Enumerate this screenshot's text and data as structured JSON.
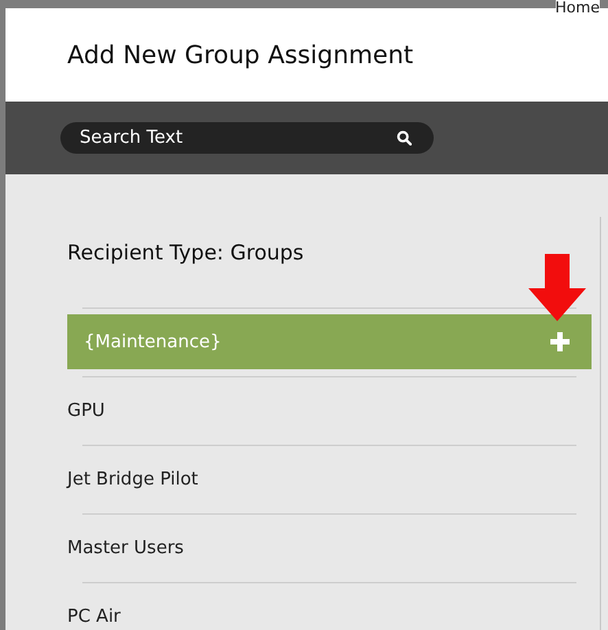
{
  "background": {
    "link": "Home"
  },
  "dialog": {
    "title": "Add New Group Assignment",
    "search": {
      "placeholder": "Search Text"
    },
    "section_title": "Recipient Type: Groups",
    "groups": [
      {
        "name": "{Maintenance}",
        "selected": true
      },
      {
        "name": "GPU",
        "selected": false
      },
      {
        "name": "Jet Bridge Pilot",
        "selected": false
      },
      {
        "name": "Master Users",
        "selected": false
      },
      {
        "name": "PC Air",
        "selected": false
      }
    ]
  }
}
